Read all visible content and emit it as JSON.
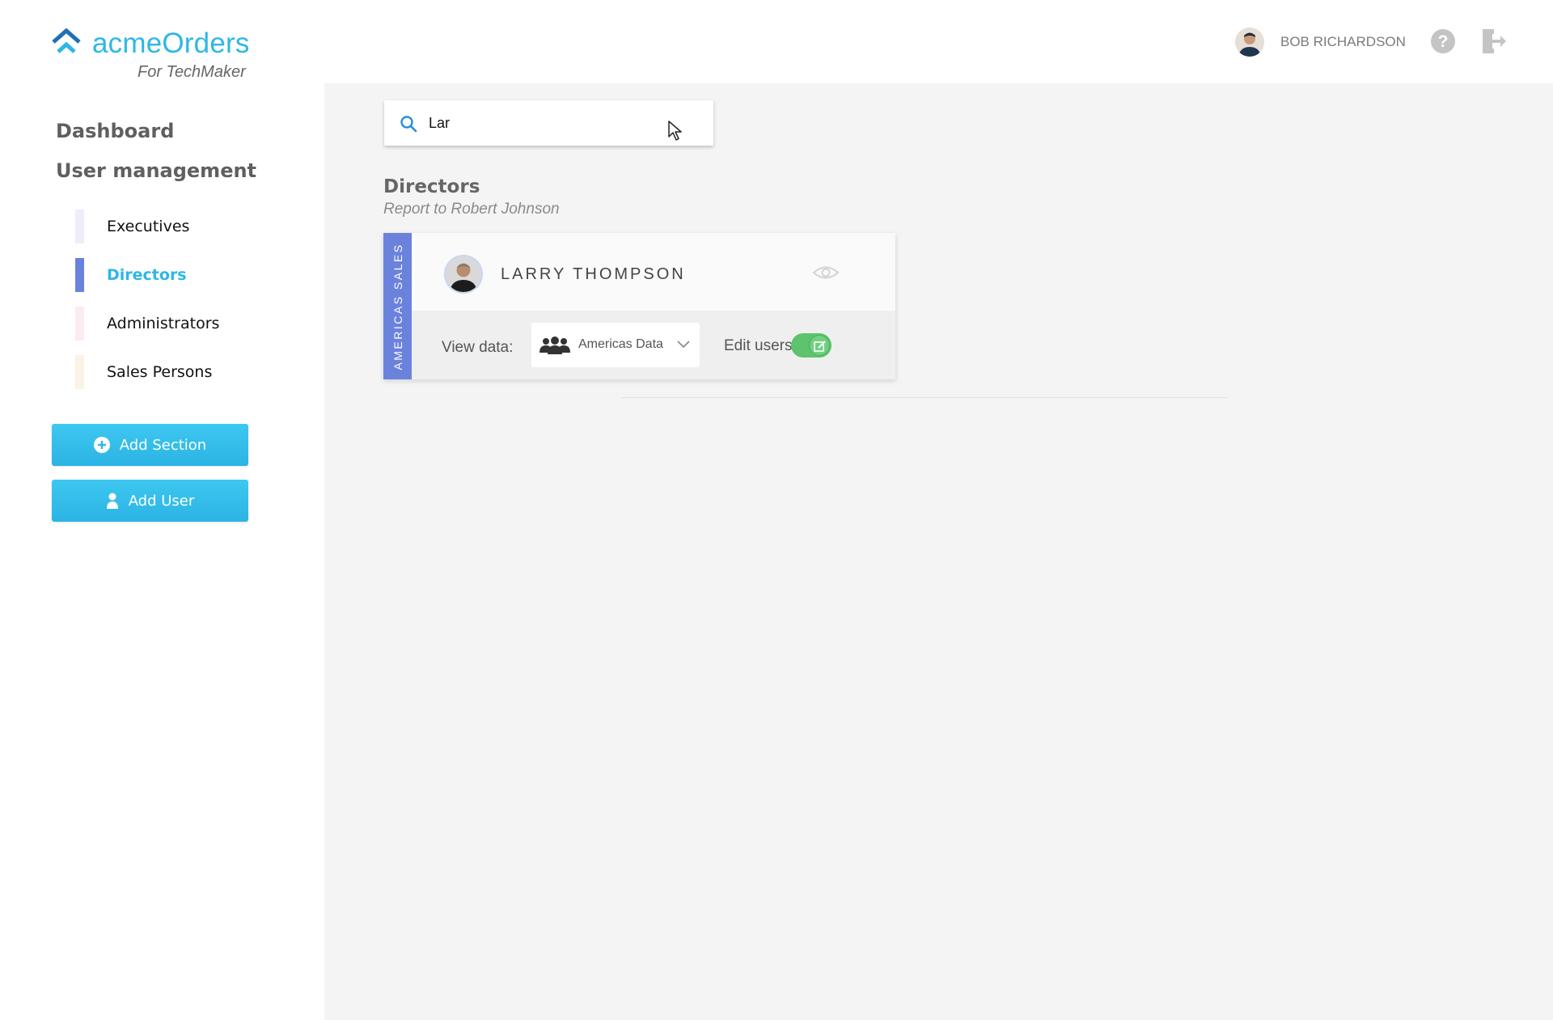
{
  "brand": {
    "name": "acmeOrders",
    "tagline": "For TechMaker",
    "logo_icon": "double-chevron-up-icon",
    "accent_color": "#2eb7e5"
  },
  "header": {
    "user_name": "BOB RICHARDSON",
    "help_icon": "question-circle-icon",
    "logout_icon": "logout-door-icon"
  },
  "nav": {
    "dashboard": "Dashboard",
    "user_management": "User management",
    "sub_items": [
      {
        "label": "Executives",
        "color": "#f0ecfb",
        "active": false
      },
      {
        "label": "Directors",
        "color": "#6b82dd",
        "active": true
      },
      {
        "label": "Administrators",
        "color": "#fcecef",
        "active": false
      },
      {
        "label": "Sales Persons",
        "color": "#faf3e6",
        "active": false
      }
    ],
    "add_section": "Add Section",
    "add_user": "Add User"
  },
  "search": {
    "value": "Lar",
    "icon": "search-icon"
  },
  "section": {
    "title": "Directors",
    "subtitle": "Report to Robert Johnson"
  },
  "card": {
    "tag": "AMERICAS SALES",
    "tag_color": "#6b82dd",
    "person_name": "LARRY THOMPSON",
    "view_data_label": "View data:",
    "view_data_value": "Americas Data",
    "edit_users_label": "Edit users:",
    "edit_users_enabled": true,
    "toggle_color": "#5dc36e"
  }
}
